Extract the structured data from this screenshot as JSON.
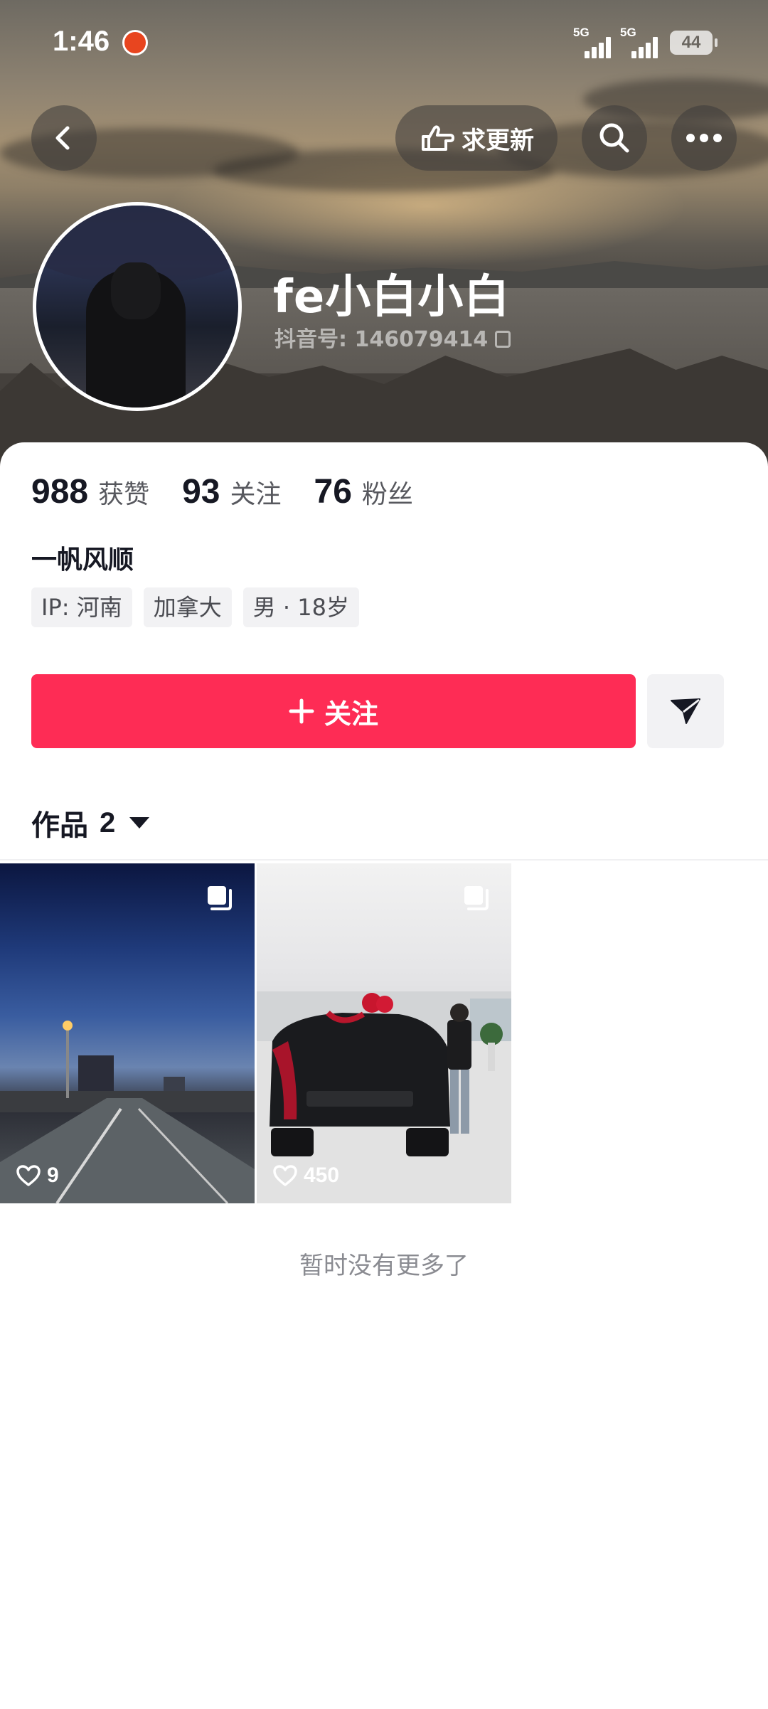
{
  "status_bar": {
    "time": "1:46",
    "signal_1_label": "5G",
    "signal_2_label": "5G",
    "battery": "44"
  },
  "header": {
    "request_update_label": "求更新",
    "nickname": "fe小白小白",
    "douyin_id": "抖音号: 146079414"
  },
  "stats": [
    {
      "value": "988",
      "label": "获赞"
    },
    {
      "value": "93",
      "label": "关注"
    },
    {
      "value": "76",
      "label": "粉丝"
    }
  ],
  "bio": "一帆风顺",
  "tags": [
    "IP: 河南",
    "加拿大",
    "男 · 18岁"
  ],
  "actions": {
    "follow_label": "关注"
  },
  "works": {
    "tab_label": "作品",
    "count": "2",
    "items": [
      {
        "likes": "9",
        "icon": "multi-image-icon"
      },
      {
        "likes": "450",
        "icon": "multi-image-icon"
      }
    ]
  },
  "footer": {
    "no_more_text": "暂时没有更多了"
  },
  "colors": {
    "accent": "#fe2c55",
    "text_primary": "#161823",
    "text_secondary": "#57585e",
    "tag_bg": "#f2f2f4"
  }
}
